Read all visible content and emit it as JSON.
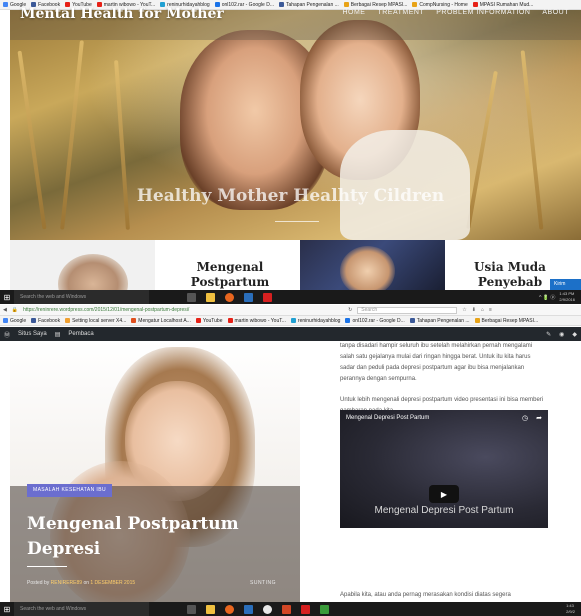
{
  "top_bookmarks": [
    {
      "label": "Google",
      "color": "#4285f4"
    },
    {
      "label": "Facebook",
      "color": "#3b5998"
    },
    {
      "label": "YouTube",
      "color": "#e62117"
    },
    {
      "label": "martin wibowo - YouT...",
      "color": "#e62117"
    },
    {
      "label": "reninurhidayahblog",
      "color": "#21a0d2"
    },
    {
      "label": "onl102.rar - Google D...",
      "color": "#1a73e8"
    },
    {
      "label": "Tahapan Pengenalan ...",
      "color": "#3b5998"
    },
    {
      "label": "Berbagai Resep MPASI...",
      "color": "#e8a317"
    },
    {
      "label": "CompNursing - Home",
      "color": "#e8a317"
    },
    {
      "label": "MPASI Rumahan Mud...",
      "color": "#e62117"
    }
  ],
  "site": {
    "title": "Mental Health for Mother",
    "nav": [
      "HOME",
      "TREATMENT",
      "PROBLEM INFORMATION",
      "ABOUT"
    ],
    "hero_tagline": "Healthy Mother Healhty Cildren"
  },
  "posts_row": {
    "post1_title": "Mengenal\nPostpartum",
    "post2_title": "Usia Muda\nPenyebab"
  },
  "taskbar": {
    "search_placeholder": "Search the web and Windows",
    "tray_text": "^ 🔋 ⓟ",
    "time": "1:43 PM",
    "date": "2/9/2016"
  },
  "notification": "Kirim",
  "browser": {
    "url": "https://reninrere.wordpress.com/2015/12/01/mengenal-postpartum-depresi/",
    "search_placeholder": "Search"
  },
  "bottom_bookmarks": [
    {
      "label": "Google",
      "color": "#4285f4"
    },
    {
      "label": "Facebook",
      "color": "#3b5998"
    },
    {
      "label": "Setting local server X4...",
      "color": "#f0a030"
    },
    {
      "label": "Mengatur Localhost A...",
      "color": "#e0501e"
    },
    {
      "label": "YouTube",
      "color": "#e62117"
    },
    {
      "label": "martin wibowo - YouT...",
      "color": "#e62117"
    },
    {
      "label": "reninurhidayahblog",
      "color": "#21a0d2"
    },
    {
      "label": "onl102.rar - Google D...",
      "color": "#1a73e8"
    },
    {
      "label": "Tahapan Pengenalan ...",
      "color": "#3b5998"
    },
    {
      "label": "Berbagai Resep MPASI...",
      "color": "#e8a317"
    }
  ],
  "wp_bar": {
    "site_label": "Situs Saya",
    "reader_label": "Pembaca"
  },
  "article": {
    "category": "MASALAH KESEHATAN IBU",
    "title": "Mengenal Postpartum Depresi",
    "posted_by": "Posted by",
    "author": "RENIRERE89",
    "on": "on",
    "date": "1 DESEMBER 2015",
    "edit_label": "SUNTING",
    "paragraph1": "tanpa disadari hampir seluruh ibu setelah melahirkan pernah mengalami salah satu gejalanya mulai dari ringan hingga berat. Untuk itu kita harus sadar dan peduli pada depresi postpartum agar ibu bisa menjalankan perannya dengan sempurna.",
    "paragraph2": "Untuk lebih mengenali depresi postpartum video presentasi ini bisa memberi gambaran pada kita.",
    "video_title": "Mengenal Depresi Post Partum",
    "video_overlay": "Mengenal Depresi Post Partum",
    "paragraph3": "Apabila kita, atau anda pernag merasakan kondisi diatas segera"
  },
  "bottom_taskbar": {
    "search_placeholder": "Search the web and Windows",
    "time": "1:43",
    "date": "2/9/2"
  }
}
